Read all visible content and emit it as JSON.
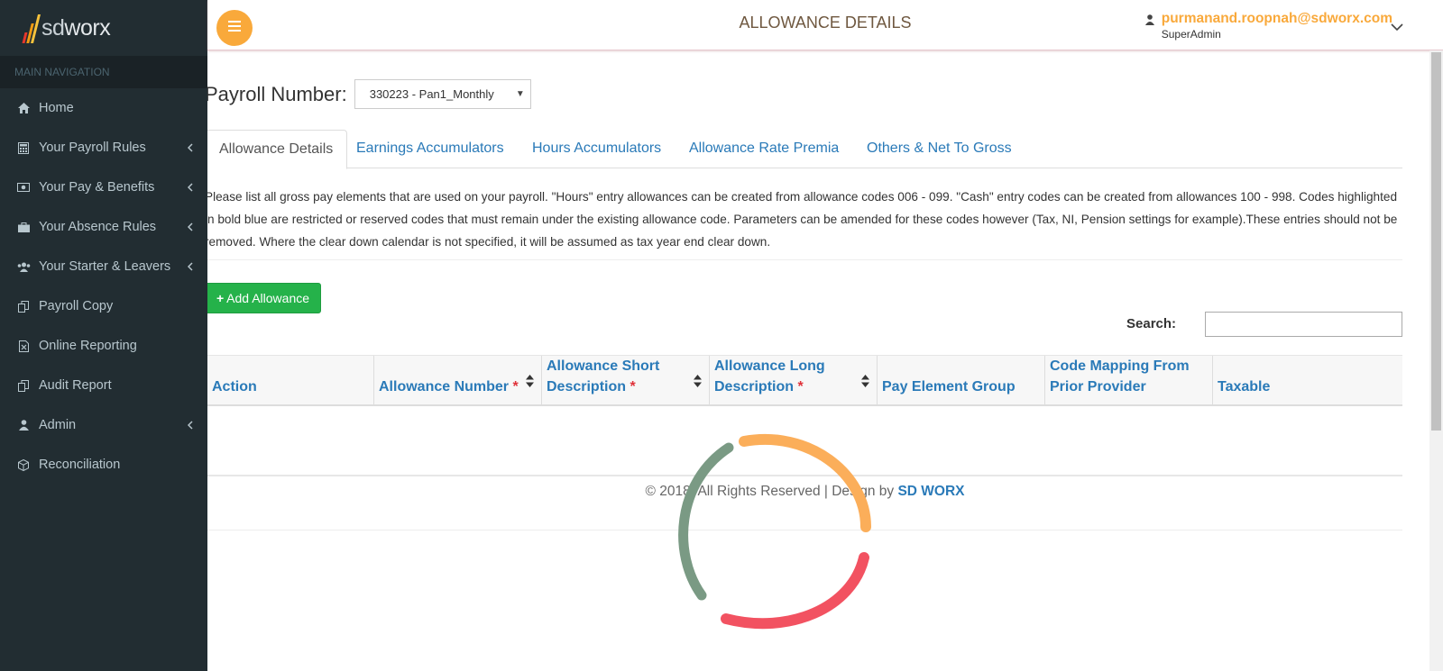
{
  "brand": {
    "logo_text_a": "sd",
    "logo_text_b": "worx",
    "bar_colors": [
      "#e8372c",
      "#f39c12",
      "#f7c23c"
    ]
  },
  "sidebar": {
    "header": "MAIN NAVIGATION",
    "items": [
      {
        "label": "Home",
        "icon": "home-icon",
        "has_children": false
      },
      {
        "label": "Your Payroll Rules",
        "icon": "calculator-icon",
        "has_children": true
      },
      {
        "label": "Your Pay & Benefits",
        "icon": "money-icon",
        "has_children": true
      },
      {
        "label": "Your Absence Rules",
        "icon": "briefcase-icon",
        "has_children": true
      },
      {
        "label": "Your Starter & Leavers",
        "icon": "users-icon",
        "has_children": true
      },
      {
        "label": "Payroll Copy",
        "icon": "copy-icon",
        "has_children": false
      },
      {
        "label": "Online Reporting",
        "icon": "excel-file-icon",
        "has_children": false
      },
      {
        "label": "Audit Report",
        "icon": "copy-icon",
        "has_children": false
      },
      {
        "label": "Admin",
        "icon": "user-icon",
        "has_children": true
      },
      {
        "label": "Reconciliation",
        "icon": "cube-icon",
        "has_children": false
      }
    ]
  },
  "header": {
    "title": "ALLOWANCE DETAILS",
    "user_email": "purmanand.roopnah@sdworx.com",
    "user_role": "SuperAdmin"
  },
  "payroll": {
    "label": "Payroll Number:",
    "selected": "330223 - Pan1_Monthly"
  },
  "tabs": [
    {
      "label": "Allowance Details",
      "active": true
    },
    {
      "label": "Earnings Accumulators",
      "active": false
    },
    {
      "label": "Hours Accumulators",
      "active": false
    },
    {
      "label": "Allowance Rate Premia",
      "active": false
    },
    {
      "label": "Others & Net To Gross",
      "active": false
    }
  ],
  "info_text": "Please list all gross pay elements that are used on your payroll. \"Hours\" entry allowances can be created from allowance codes 006 - 099. \"Cash\" entry codes can be created from allowances 100 - 998. Codes highlighted in bold blue are restricted or reserved codes that must remain under the existing allowance code. Parameters can be amended for these codes however (Tax, NI, Pension settings for example).These entries should not be removed. Where the clear down calendar is not specified, it will be assumed as tax year end clear down.",
  "add_button": {
    "plus": "+",
    "label": "Add Allowance"
  },
  "search": {
    "label": "Search:",
    "value": ""
  },
  "table": {
    "columns": [
      {
        "label": "Action",
        "required": false,
        "sortable": false
      },
      {
        "label": "Allowance Number",
        "required": true,
        "sortable": true
      },
      {
        "label": "Allowance Short Description",
        "required": true,
        "sortable": true
      },
      {
        "label": "Allowance Long Description",
        "required": true,
        "sortable": true
      },
      {
        "label": "Pay Element Group",
        "required": false,
        "sortable": false
      },
      {
        "label": "Code Mapping From Prior Provider",
        "required": false,
        "sortable": false
      },
      {
        "label": "Taxable",
        "required": false,
        "sortable": false
      }
    ],
    "required_mark": "*"
  },
  "footer": {
    "text": "© 2018. All Rights Reserved | Design by ",
    "brand": "SD WORX"
  },
  "colors": {
    "sidebar_bg": "#222d32",
    "accent_orange": "#f9a93b",
    "link_blue": "#2a7ab8",
    "button_green": "#25b24a",
    "loader_orange": "#fbae5a",
    "loader_red": "#f25261",
    "loader_green": "#7a9a84"
  }
}
